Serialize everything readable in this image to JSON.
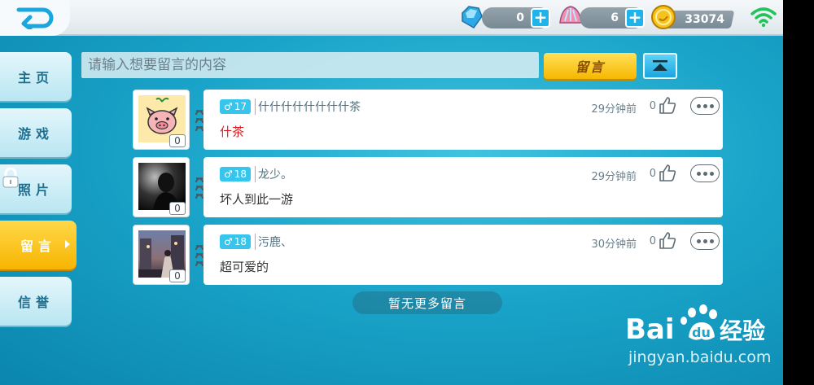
{
  "topbar": {
    "diamonds": "0",
    "shells": "6",
    "coins": "33074"
  },
  "sidebar": {
    "items": [
      {
        "label": "主页"
      },
      {
        "label": "游戏"
      },
      {
        "label": "照片"
      },
      {
        "label": "留言"
      },
      {
        "label": "信誉"
      }
    ]
  },
  "compose": {
    "placeholder": "请输入想要留言的内容",
    "post_label": "留言"
  },
  "messages": [
    {
      "age": "17",
      "nick": "什什什什什什什什茶",
      "text": "什茶",
      "time": "29分钟前",
      "likes": "0",
      "photos": "0"
    },
    {
      "age": "18",
      "nick": "龙少。",
      "text": "坏人到此一游",
      "time": "29分钟前",
      "likes": "0",
      "photos": "0"
    },
    {
      "age": "18",
      "nick": "污鹿、",
      "text": "超可爱的",
      "time": "30分钟前",
      "likes": "0",
      "photos": "0"
    }
  ],
  "footer": {
    "no_more": "暂无更多留言"
  },
  "watermark": {
    "logo": "Baidu经验",
    "url": "jingyan.baidu.com"
  },
  "colors": {
    "accent_yellow": "#f7b500",
    "accent_blue": "#36c5ec",
    "bg_teal": "#1aa4c9"
  }
}
